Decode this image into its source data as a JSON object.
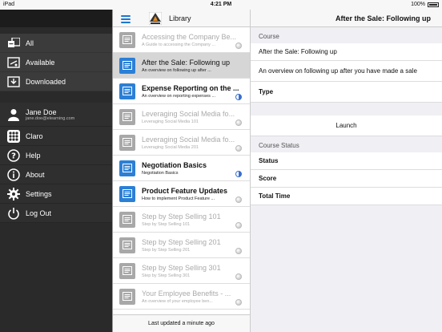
{
  "status_bar": {
    "carrier": "iPad",
    "time": "4:21 PM",
    "battery": "100%"
  },
  "sidebar": {
    "items": [
      {
        "label": "All",
        "icon": "all-courses-icon"
      },
      {
        "label": "Available",
        "icon": "available-icon"
      },
      {
        "label": "Downloaded",
        "icon": "downloaded-icon"
      }
    ],
    "user": {
      "name": "Jane Doe",
      "email": "jane.doe@elearning.com"
    },
    "links": [
      {
        "label": "Claro",
        "icon": "grid-icon"
      },
      {
        "label": "Help",
        "icon": "help-icon"
      },
      {
        "label": "About",
        "icon": "info-icon"
      },
      {
        "label": "Settings",
        "icon": "gear-icon"
      },
      {
        "label": "Log Out",
        "icon": "power-icon"
      }
    ]
  },
  "library": {
    "title": "Library",
    "footer": "Last updated a minute ago",
    "courses": [
      {
        "title": "Accessing the Company Be...",
        "subtitle": "A Guide to accessing the Company ...",
        "state": "dim",
        "thumb": "gray"
      },
      {
        "title": "After the Sale: Following up",
        "subtitle": "An overview on following up after ...",
        "state": "selected",
        "thumb": "blue"
      },
      {
        "title": "Expense Reporting on the ...",
        "subtitle": "An overview on reporting expenses ...",
        "state": "bold-progress",
        "thumb": "blue"
      },
      {
        "title": "Leveraging Social Media fo...",
        "subtitle": "Leveraging Social Media 101",
        "state": "dim",
        "thumb": "gray"
      },
      {
        "title": "Leveraging Social Media fo...",
        "subtitle": "Leveraging Social Media 201",
        "state": "dim",
        "thumb": "gray"
      },
      {
        "title": "Negotiation Basics",
        "subtitle": "Negotiation Basics",
        "state": "bold-progress",
        "thumb": "blue"
      },
      {
        "title": "Product Feature Updates",
        "subtitle": "How to implement Product Feature ...",
        "state": "bold-dot",
        "thumb": "blue"
      },
      {
        "title": "Step by Step Selling 101",
        "subtitle": "Step by Step Selling 101",
        "state": "dim",
        "thumb": "gray"
      },
      {
        "title": "Step by Step Selling 201",
        "subtitle": "Step by Step Selling 201",
        "state": "dim",
        "thumb": "gray"
      },
      {
        "title": "Step by Step Selling 301",
        "subtitle": "Step by Step Selling 301",
        "state": "dim",
        "thumb": "gray"
      },
      {
        "title": "Your Employee Benefits - ...",
        "subtitle": "An overview of your employee ben...",
        "state": "dim",
        "thumb": "gray"
      }
    ]
  },
  "detail": {
    "title": "After the Sale: Following up",
    "course_header": "Course",
    "course_name": "After the Sale: Following up",
    "course_desc": "An overview on following up after you have made a sale",
    "type_label": "Type",
    "launch_label": "Launch",
    "status_header": "Course Status",
    "status_label": "Status",
    "score_label": "Score",
    "time_label": "Total Time"
  }
}
